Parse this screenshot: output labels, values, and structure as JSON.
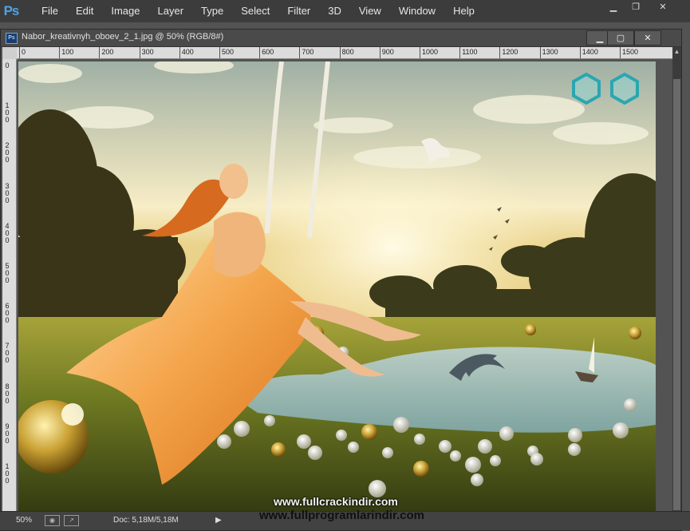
{
  "app": {
    "logo": "Ps"
  },
  "menu": [
    "File",
    "Edit",
    "Image",
    "Layer",
    "Type",
    "Select",
    "Filter",
    "3D",
    "View",
    "Window",
    "Help"
  ],
  "document": {
    "title": "Nabor_kreativnyh_oboev_2_1.jpg @ 50% (RGB/8#)",
    "icon": "Ps"
  },
  "ruler": {
    "h_labels": [
      "0",
      "100",
      "200",
      "300",
      "400",
      "500",
      "600",
      "700",
      "800",
      "900",
      "1000",
      "1100",
      "1200",
      "1300",
      "1400",
      "1500"
    ],
    "v_labels": [
      "0",
      "100",
      "200",
      "300",
      "400",
      "500",
      "600",
      "700",
      "800",
      "900",
      "100"
    ]
  },
  "status": {
    "zoom": "50%",
    "doc_size": "Doc: 5,18M/5,18M"
  },
  "watermarks": {
    "line1": "www.fullcrackindir.com",
    "line2": "www.fullprogramlarindir.com"
  },
  "colors": {
    "menubar": "#3c3c3c",
    "ruler": "#dcdcdc",
    "ps_blue": "#4fa3e6"
  }
}
